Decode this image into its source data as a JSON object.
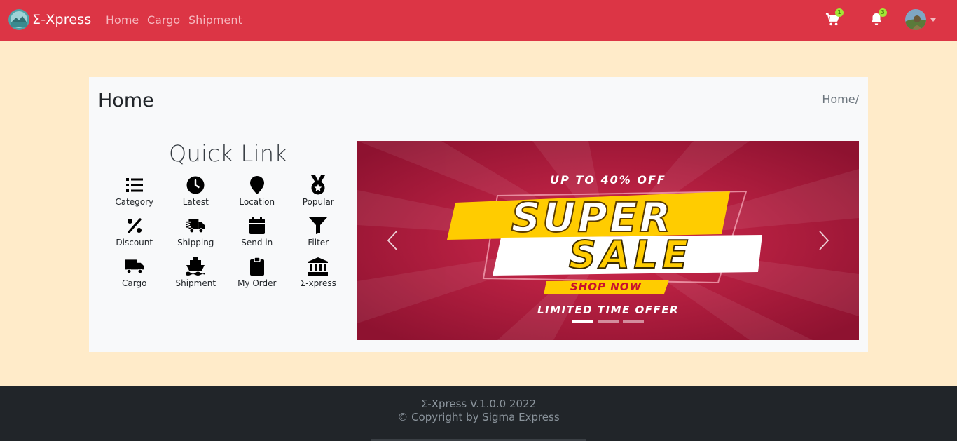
{
  "navbar": {
    "brand": "Σ-Xpress",
    "links": [
      "Home",
      "Cargo",
      "Shipment"
    ],
    "cart_badge": "1",
    "notifications_badge": "3",
    "bg_color": "#dc3545"
  },
  "page": {
    "title": "Home",
    "breadcrumb": "Home/"
  },
  "quick_link": {
    "title": "Quick Link",
    "items": [
      {
        "label": "Category",
        "icon": "list-icon"
      },
      {
        "label": "Latest",
        "icon": "clock-icon"
      },
      {
        "label": "Location",
        "icon": "map-pin-icon"
      },
      {
        "label": "Popular",
        "icon": "medal-icon"
      },
      {
        "label": "Discount",
        "icon": "percent-icon"
      },
      {
        "label": "Shipping",
        "icon": "fast-truck-icon"
      },
      {
        "label": "Send in",
        "icon": "calendar-icon"
      },
      {
        "label": "Filter",
        "icon": "filter-icon"
      },
      {
        "label": "Cargo",
        "icon": "truck-icon"
      },
      {
        "label": "Shipment",
        "icon": "ship-icon"
      },
      {
        "label": "My Order",
        "icon": "clipboard-icon"
      },
      {
        "label": "Σ-xpress",
        "icon": "bank-icon"
      }
    ]
  },
  "carousel": {
    "line1": "UP TO 40% OFF",
    "line2": "SUPER",
    "line3": "SALE",
    "cta": "SHOP NOW",
    "line4": "LIMITED TIME OFFER",
    "slide_count": 3,
    "active_slide": 1,
    "colors": {
      "bg": "#b0163a",
      "accent": "#ffcc00"
    }
  },
  "footer": {
    "version": "Σ-Xpress V.1.0.0 2022",
    "copyright": "© Copyright by Sigma Express"
  }
}
